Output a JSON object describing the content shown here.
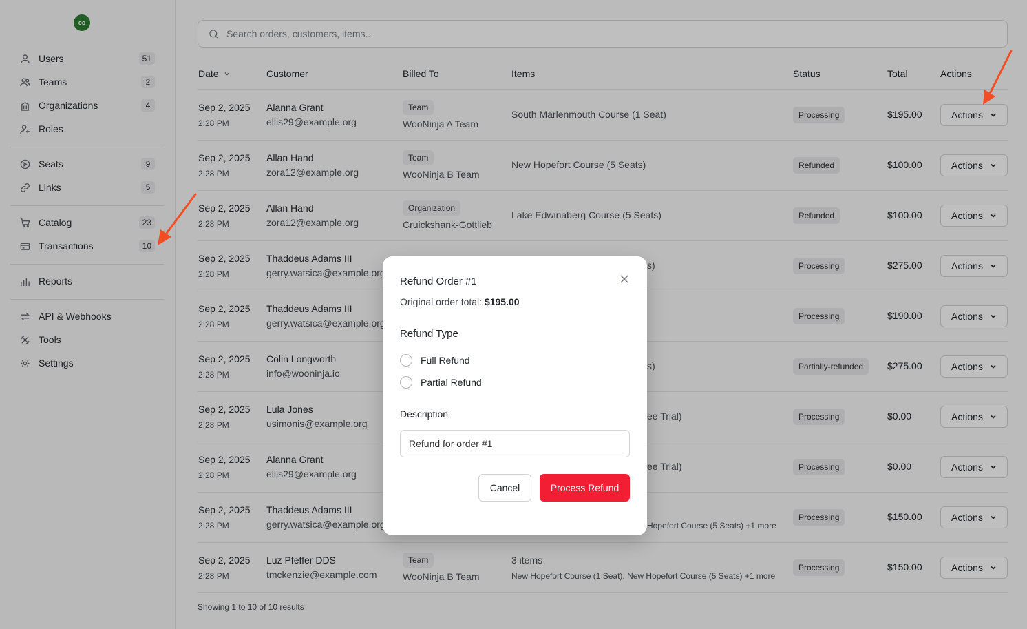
{
  "user": {
    "initials": "co"
  },
  "sidebar": {
    "groups": [
      [
        {
          "label": "Users",
          "count": "51",
          "icon": "user-icon"
        },
        {
          "label": "Teams",
          "count": "2",
          "icon": "users-icon"
        },
        {
          "label": "Organizations",
          "count": "4",
          "icon": "building-icon"
        },
        {
          "label": "Roles",
          "count": "",
          "icon": "user-plus-icon"
        }
      ],
      [
        {
          "label": "Seats",
          "count": "9",
          "icon": "seat-icon"
        },
        {
          "label": "Links",
          "count": "5",
          "icon": "link-icon"
        }
      ],
      [
        {
          "label": "Catalog",
          "count": "23",
          "icon": "cart-icon"
        },
        {
          "label": "Transactions",
          "count": "10",
          "icon": "credit-card-icon"
        }
      ],
      [
        {
          "label": "Reports",
          "count": "",
          "icon": "bar-chart-icon"
        }
      ],
      [
        {
          "label": "API & Webhooks",
          "count": "",
          "icon": "arrows-icon"
        },
        {
          "label": "Tools",
          "count": "",
          "icon": "tools-icon"
        },
        {
          "label": "Settings",
          "count": "",
          "icon": "gear-icon"
        }
      ]
    ]
  },
  "search": {
    "placeholder": "Search orders, customers, items..."
  },
  "table": {
    "headers": {
      "date": "Date",
      "customer": "Customer",
      "billed_to": "Billed To",
      "items": "Items",
      "status": "Status",
      "total": "Total",
      "actions": "Actions"
    },
    "rows": [
      {
        "date": "Sep 2, 2025",
        "time": "2:28 PM",
        "name": "Alanna Grant",
        "email": "ellis29@example.org",
        "bill_type": "Team",
        "bill_name": "WooNinja A Team",
        "items": "South Marlenmouth Course (1 Seat)",
        "status": "Processing",
        "total": "$195.00",
        "action": "Actions"
      },
      {
        "date": "Sep 2, 2025",
        "time": "2:28 PM",
        "name": "Allan Hand",
        "email": "zora12@example.org",
        "bill_type": "Team",
        "bill_name": "WooNinja B Team",
        "items": "New Hopefort Course (5 Seats)",
        "status": "Refunded",
        "total": "$100.00",
        "action": "Actions"
      },
      {
        "date": "Sep 2, 2025",
        "time": "2:28 PM",
        "name": "Allan Hand",
        "email": "zora12@example.org",
        "bill_type": "Organization",
        "bill_name": "Cruickshank-Gottlieb",
        "items": "Lake Edwinaberg Course (5 Seats)",
        "status": "Refunded",
        "total": "$100.00",
        "action": "Actions"
      },
      {
        "date": "Sep 2, 2025",
        "time": "2:28 PM",
        "name": "Thaddeus Adams III",
        "email": "gerry.watsica@example.org",
        "bill_type": "",
        "bill_name": "",
        "items": "s)",
        "status": "Processing",
        "total": "$275.00",
        "action": "Actions"
      },
      {
        "date": "Sep 2, 2025",
        "time": "2:28 PM",
        "name": "Thaddeus Adams III",
        "email": "gerry.watsica@example.org",
        "bill_type": "",
        "bill_name": "",
        "items": "",
        "status": "Processing",
        "total": "$190.00",
        "action": "Actions"
      },
      {
        "date": "Sep 2, 2025",
        "time": "2:28 PM",
        "name": "Colin Longworth",
        "email": "info@wooninja.io",
        "bill_type": "",
        "bill_name": "",
        "items": "s)",
        "status": "Partially-refunded",
        "total": "$275.00",
        "action": "Actions"
      },
      {
        "date": "Sep 2, 2025",
        "time": "2:28 PM",
        "name": "Lula Jones",
        "email": "usimonis@example.org",
        "bill_type": "",
        "bill_name": "",
        "items": "ee Trial)",
        "status": "Processing",
        "total": "$0.00",
        "action": "Actions"
      },
      {
        "date": "Sep 2, 2025",
        "time": "2:28 PM",
        "name": "Alanna Grant",
        "email": "ellis29@example.org",
        "bill_type": "",
        "bill_name": "",
        "items": "ee Trial)",
        "status": "Processing",
        "total": "$0.00",
        "action": "Actions"
      },
      {
        "date": "Sep 2, 2025",
        "time": "2:28 PM",
        "name": "Thaddeus Adams III",
        "email": "gerry.watsica@example.org",
        "bill_type": "",
        "bill_name": "",
        "items_sub": "Hopefort Course (5 Seats) +1 more",
        "status": "Processing",
        "total": "$150.00",
        "action": "Actions"
      },
      {
        "date": "Sep 2, 2025",
        "time": "2:28 PM",
        "name": "Luz Pfeffer DDS",
        "email": "tmckenzie@example.com",
        "bill_type": "Team",
        "bill_name": "WooNinja B Team",
        "items_count": "3 items",
        "items_sub": "New Hopefort Course (1 Seat), New Hopefort Course (5 Seats) +1 more",
        "status": "Processing",
        "total": "$150.00",
        "action": "Actions"
      }
    ],
    "footer": "Showing 1 to 10 of 10 results"
  },
  "modal": {
    "title": "Refund Order #1",
    "original_label": "Original order total: ",
    "original_value": "$195.00",
    "refund_type_label": "Refund Type",
    "options": [
      "Full Refund",
      "Partial Refund"
    ],
    "description_label": "Description",
    "description_value": "Refund for order #1",
    "cancel_label": "Cancel",
    "submit_label": "Process Refund"
  },
  "colors": {
    "accent": "#f21f34",
    "arrow": "#f04e23",
    "avatar": "#2e7d32"
  }
}
